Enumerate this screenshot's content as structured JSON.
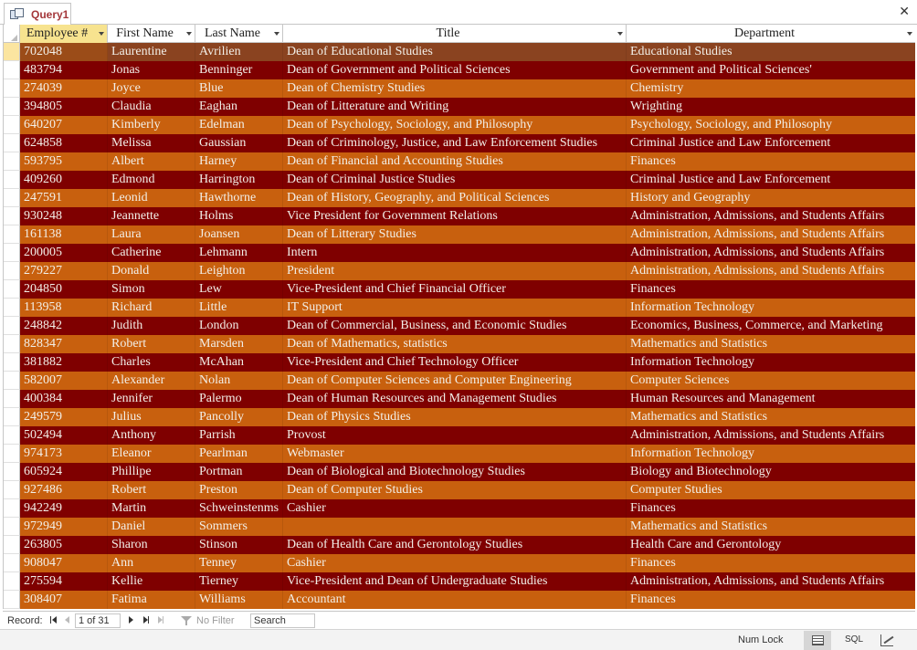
{
  "tab": {
    "label": "Query1",
    "close": "✕"
  },
  "columns": [
    "Employee #",
    "First Name",
    "Last Name",
    "Title",
    "Department"
  ],
  "rows": [
    [
      "702048",
      "Laurentine",
      "Avrilien",
      "Dean of Educational Studies",
      "Educational Studies"
    ],
    [
      "483794",
      "Jonas",
      "Benninger",
      "Dean of Government and Political Sciences",
      "Government and Political Sciences'"
    ],
    [
      "274039",
      "Joyce",
      "Blue",
      "Dean of Chemistry Studies",
      "Chemistry"
    ],
    [
      "394805",
      "Claudia",
      "Eaghan",
      "Dean of Litterature and Writing",
      "Wrighting"
    ],
    [
      "640207",
      "Kimberly",
      "Edelman",
      "Dean of Psychology, Sociology, and Philosophy",
      "Psychology, Sociology, and Philosophy"
    ],
    [
      "624858",
      "Melissa",
      "Gaussian",
      "Dean of Criminology, Justice, and Law Enforcement Studies",
      "Criminal Justice and Law Enforcement"
    ],
    [
      "593795",
      "Albert",
      "Harney",
      "Dean of Financial and Accounting Studies",
      "Finances"
    ],
    [
      "409260",
      "Edmond",
      "Harrington",
      "Dean of Criminal Justice Studies",
      "Criminal Justice and Law Enforcement"
    ],
    [
      "247591",
      "Leonid",
      "Hawthorne",
      "Dean of History, Geography, and Political Sciences",
      "History and Geography"
    ],
    [
      "930248",
      "Jeannette",
      "Holms",
      "Vice President for Government Relations",
      "Administration, Admissions, and Students Affairs"
    ],
    [
      "161138",
      "Laura",
      "Joansen",
      "Dean of Litterary Studies",
      "Administration, Admissions, and Students Affairs"
    ],
    [
      "200005",
      "Catherine",
      "Lehmann",
      "Intern",
      "Administration, Admissions, and Students Affairs"
    ],
    [
      "279227",
      "Donald",
      "Leighton",
      "President",
      "Administration, Admissions, and Students Affairs"
    ],
    [
      "204850",
      "Simon",
      "Lew",
      "Vice-President and Chief Financial Officer",
      "Finances"
    ],
    [
      "113958",
      "Richard",
      "Little",
      "IT Support",
      "Information Technology"
    ],
    [
      "248842",
      "Judith",
      "London",
      "Dean of Commercial, Business, and Economic Studies",
      "Economics, Business, Commerce, and Marketing"
    ],
    [
      "828347",
      "Robert",
      "Marsden",
      "Dean of Mathematics, statistics",
      "Mathematics and Statistics"
    ],
    [
      "381882",
      "Charles",
      "McAhan",
      "Vice-President and Chief Technology Officer",
      "Information Technology"
    ],
    [
      "582007",
      "Alexander",
      "Nolan",
      "Dean of Computer Sciences and Computer Engineering",
      "Computer Sciences"
    ],
    [
      "400384",
      "Jennifer",
      "Palermo",
      "Dean of Human Resources and Management Studies",
      "Human Resources and Management"
    ],
    [
      "249579",
      "Julius",
      "Pancolly",
      "Dean of Physics Studies",
      "Mathematics and Statistics"
    ],
    [
      "502494",
      "Anthony",
      "Parrish",
      "Provost",
      "Administration, Admissions, and Students Affairs"
    ],
    [
      "974173",
      "Eleanor",
      "Pearlman",
      "Webmaster",
      "Information Technology"
    ],
    [
      "605924",
      "Phillipe",
      "Portman",
      "Dean of Biological and Biotechnology Studies",
      "Biology and Biotechnology"
    ],
    [
      "927486",
      "Robert",
      "Preston",
      "Dean of Computer Studies",
      "Computer Studies"
    ],
    [
      "942249",
      "Martin",
      "Schweinstenms",
      "Cashier",
      "Finances"
    ],
    [
      "972949",
      "Daniel",
      "Sommers",
      "",
      "Mathematics and Statistics"
    ],
    [
      "263805",
      "Sharon",
      "Stinson",
      "Dean of Health Care and Gerontology Studies",
      "Health Care and Gerontology"
    ],
    [
      "908047",
      "Ann",
      "Tenney",
      "Cashier",
      "Finances"
    ],
    [
      "275594",
      "Kellie",
      "Tierney",
      "Vice-President and Dean of Undergraduate Studies",
      "Administration, Admissions, and Students Affairs"
    ],
    [
      "308407",
      "Fatima",
      "Williams",
      "Accountant",
      "Finances"
    ]
  ],
  "nav": {
    "record_label": "Record:",
    "record_value": "1 of 31",
    "no_filter": "No Filter",
    "search_placeholder": "Search"
  },
  "status": {
    "num_lock": "Num Lock",
    "sql": "SQL"
  },
  "colors": {
    "row_odd": "#c8600e",
    "row_even": "#7f0000",
    "header_active": "#f7e38f",
    "tab_text": "#a4373a"
  }
}
